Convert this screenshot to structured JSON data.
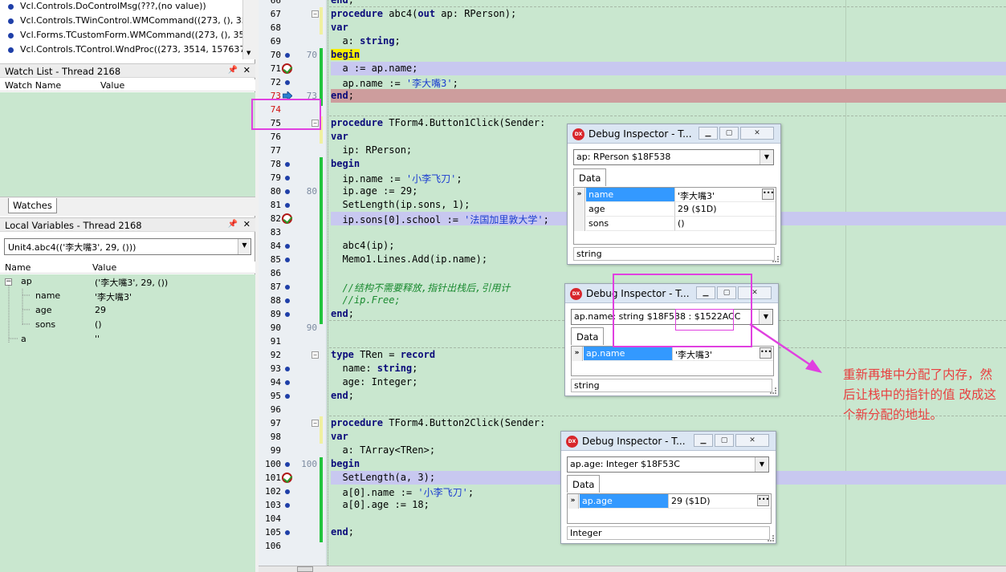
{
  "call_stack": {
    "items": [
      "Vcl.Controls.DoControlMsg(???,(no value))",
      "Vcl.Controls.TWinControl.WMCommand((273, (), 35",
      "Vcl.Forms.TCustomForm.WMCommand((273, (), 35",
      "Vcl.Controls.TControl.WndProc((273, 3514, 1576378,"
    ]
  },
  "watch_list": {
    "title": "Watch List - Thread 2168",
    "col_name": "Watch Name",
    "col_value": "Value",
    "tab": "Watches"
  },
  "local_vars": {
    "title": "Local Variables - Thread 2168",
    "frame": "Unit4.abc4(('李大嘴3', 29, ()))",
    "col_name": "Name",
    "col_value": "Value",
    "rows": [
      {
        "name": "ap",
        "value": "('李大嘴3', 29, ())"
      },
      {
        "name": "name",
        "value": "'李大嘴3'"
      },
      {
        "name": "age",
        "value": "29"
      },
      {
        "name": "sons",
        "value": "()"
      },
      {
        "name": "a",
        "value": "''"
      }
    ]
  },
  "editor": {
    "lines": [
      {
        "n": "66",
        "sub": "",
        "code": "end;"
      },
      {
        "n": "67",
        "sub": "",
        "code": "procedure abc4(out ap: RPerson);"
      },
      {
        "n": "68",
        "sub": "",
        "code": "var"
      },
      {
        "n": "69",
        "sub": "",
        "code": "  a: string;"
      },
      {
        "n": "70",
        "sub": "70",
        "code": "begin"
      },
      {
        "n": "71",
        "sub": "",
        "code": "  a := ap.name;"
      },
      {
        "n": "72",
        "sub": "",
        "code": "  ap.name := '李大嘴3';"
      },
      {
        "n": "73",
        "sub": "73",
        "code": "end;"
      },
      {
        "n": "74",
        "sub": "",
        "code": ""
      },
      {
        "n": "75",
        "sub": "",
        "code": "procedure TForm4.Button1Click(Sender:"
      },
      {
        "n": "76",
        "sub": "",
        "code": "var"
      },
      {
        "n": "77",
        "sub": "",
        "code": "  ip: RPerson;"
      },
      {
        "n": "78",
        "sub": "",
        "code": "begin"
      },
      {
        "n": "79",
        "sub": "",
        "code": "  ip.name := '小李飞刀';"
      },
      {
        "n": "80",
        "sub": "80",
        "code": "  ip.age := 29;"
      },
      {
        "n": "81",
        "sub": "",
        "code": "  SetLength(ip.sons, 1);"
      },
      {
        "n": "82",
        "sub": "",
        "code": "  ip.sons[0].school := '法国加里敦大学';"
      },
      {
        "n": "83",
        "sub": "",
        "code": ""
      },
      {
        "n": "84",
        "sub": "",
        "code": "  abc4(ip);"
      },
      {
        "n": "85",
        "sub": "",
        "code": "  Memo1.Lines.Add(ip.name);"
      },
      {
        "n": "86",
        "sub": "",
        "code": ""
      },
      {
        "n": "87",
        "sub": "",
        "code": "  //结构不需要释放,指针出栈后,引用计"
      },
      {
        "n": "88",
        "sub": "",
        "code": "  //ip.Free;"
      },
      {
        "n": "89",
        "sub": "",
        "code": "end;"
      },
      {
        "n": "90",
        "sub": "90",
        "code": ""
      },
      {
        "n": "91",
        "sub": "",
        "code": ""
      },
      {
        "n": "92",
        "sub": "",
        "code": "type TRen = record"
      },
      {
        "n": "93",
        "sub": "",
        "code": "  name: string;"
      },
      {
        "n": "94",
        "sub": "",
        "code": "  age: Integer;"
      },
      {
        "n": "95",
        "sub": "",
        "code": "end;"
      },
      {
        "n": "96",
        "sub": "",
        "code": ""
      },
      {
        "n": "97",
        "sub": "",
        "code": "procedure TForm4.Button2Click(Sender:"
      },
      {
        "n": "98",
        "sub": "",
        "code": "var"
      },
      {
        "n": "99",
        "sub": "",
        "code": "  a: TArray<TRen>;"
      },
      {
        "n": "100",
        "sub": "100",
        "code": "begin"
      },
      {
        "n": "101",
        "sub": "",
        "code": "  SetLength(a, 3);"
      },
      {
        "n": "102",
        "sub": "",
        "code": "  a[0].name := '小李飞刀';"
      },
      {
        "n": "103",
        "sub": "",
        "code": "  a[0].age := 18;"
      },
      {
        "n": "104",
        "sub": "",
        "code": ""
      },
      {
        "n": "105",
        "sub": "",
        "code": "end;"
      },
      {
        "n": "106",
        "sub": "",
        "code": ""
      }
    ]
  },
  "inspectors": [
    {
      "title": "Debug Inspector - T...",
      "logo": "DX",
      "combo": "ap: RPerson $18F538",
      "tab": "Data",
      "rows": [
        {
          "name": "name",
          "value": "'李大嘴3'"
        },
        {
          "name": "age",
          "value": "29 ($1D)"
        },
        {
          "name": "sons",
          "value": "()"
        }
      ],
      "status": "string"
    },
    {
      "title": "Debug Inspector - T...",
      "logo": "DX",
      "combo": "ap.name: string $18F538 : $1522ACC",
      "tab": "Data",
      "rows": [
        {
          "name": "ap.name",
          "value": "'李大嘴3'"
        }
      ],
      "status": "string"
    },
    {
      "title": "Debug Inspector - T...",
      "logo": "DX",
      "combo": "ap.age: Integer $18F53C",
      "tab": "Data",
      "rows": [
        {
          "name": "ap.age",
          "value": "29 ($1D)"
        }
      ],
      "status": "Integer"
    }
  ],
  "annotation": {
    "text": "重新再堆中分配了内存，然后让栈中的指针的值 改成这个新分配的地址。"
  },
  "colors": {
    "editor_bg": "#c9e7cf",
    "exec_line": "#cd9d9d",
    "breakpoint_line": "#c8c8f0",
    "annotation_magenta": "#e040e0",
    "annotation_text": "#e84040"
  }
}
